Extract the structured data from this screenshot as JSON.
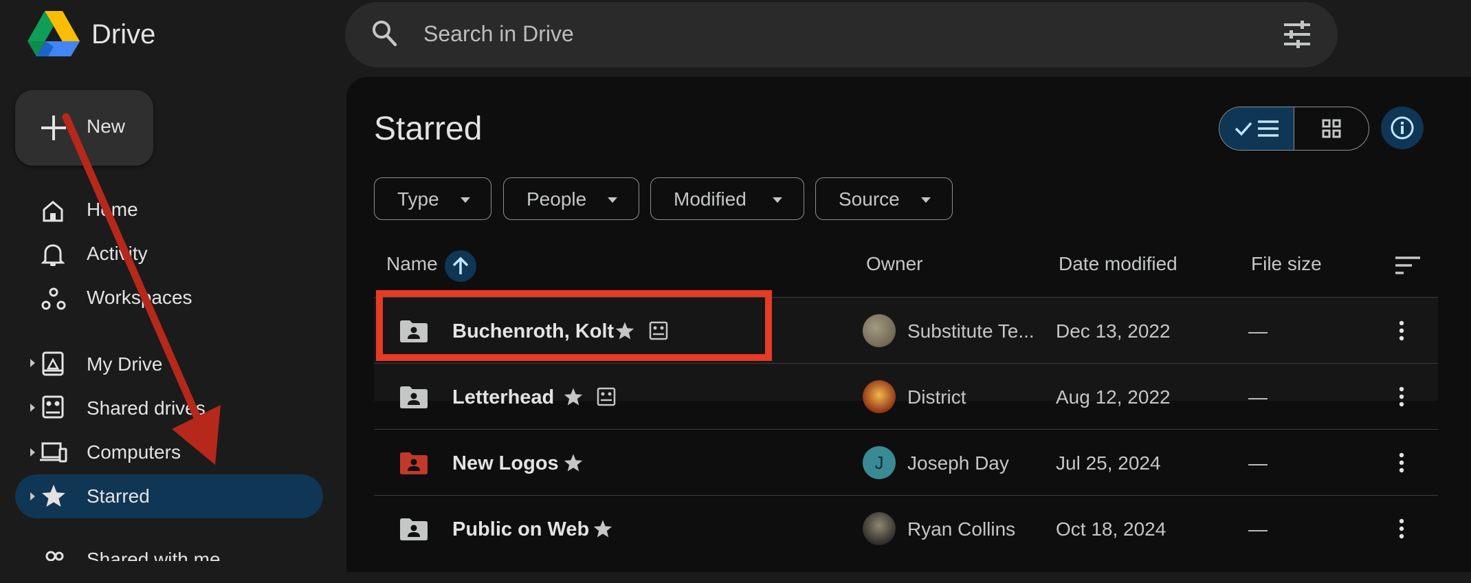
{
  "app": {
    "title": "Drive"
  },
  "search": {
    "placeholder": "Search in Drive"
  },
  "new_button": {
    "label": "New"
  },
  "sidebar": {
    "items": [
      {
        "label": "Home",
        "icon": "home-icon"
      },
      {
        "label": "Activity",
        "icon": "bell-icon"
      },
      {
        "label": "Workspaces",
        "icon": "workspaces-icon"
      },
      {
        "label": "My Drive",
        "icon": "my-drive-icon"
      },
      {
        "label": "Shared drives",
        "icon": "shared-drives-icon"
      },
      {
        "label": "Computers",
        "icon": "computers-icon"
      },
      {
        "label": "Starred",
        "icon": "star-icon",
        "active": true
      },
      {
        "label": "Shared with me",
        "icon": "people-icon"
      }
    ]
  },
  "page": {
    "title": "Starred"
  },
  "filters": [
    {
      "label": "Type"
    },
    {
      "label": "People"
    },
    {
      "label": "Modified"
    },
    {
      "label": "Source"
    }
  ],
  "table": {
    "columns": [
      "Name",
      "Owner",
      "Date modified",
      "File size"
    ],
    "rows": [
      {
        "name": "Buchenroth, Kolt",
        "owner": "Substitute Te...",
        "date": "Dec 13, 2022",
        "size": "—",
        "folder_color": "#c4c7c5",
        "shared_drive_badge": true
      },
      {
        "name": "Letterhead",
        "owner": "District",
        "date": "Aug 12, 2022",
        "size": "—",
        "folder_color": "#c4c7c5",
        "shared_drive_badge": true
      },
      {
        "name": "New Logos",
        "owner": "Joseph Day",
        "owner_initial": "J",
        "date": "Jul 25, 2024",
        "size": "—",
        "folder_color": "#c0392b",
        "shared_drive_badge": false
      },
      {
        "name": "Public on Web",
        "owner": "Ryan Collins",
        "date": "Oct 18, 2024",
        "size": "—",
        "folder_color": "#c4c7c5",
        "shared_drive_badge": false
      }
    ]
  },
  "colors": {
    "accent": "#0f3655",
    "highlight": "#e63b24",
    "arrow": "#b5281b"
  }
}
